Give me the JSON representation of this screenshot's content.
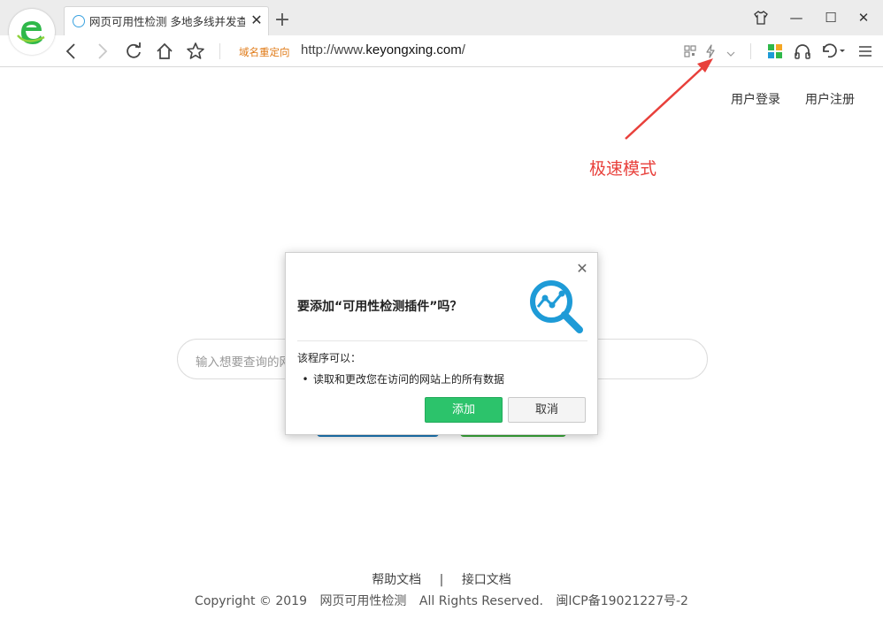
{
  "browser": {
    "tab": {
      "title": "网页可用性检测 多地多线并发查询"
    },
    "address": {
      "redirect_label": "域名重定向",
      "url_prefix": "http://www.",
      "url_domain": "keyongxing.com",
      "url_suffix": "/"
    }
  },
  "page": {
    "top_links": [
      "用户登录",
      "用户注册"
    ],
    "annotation": "极速模式",
    "search_placeholder": "输入想要查询的网",
    "footer": {
      "links": [
        "帮助文档",
        "|",
        "接口文档"
      ],
      "copyright": [
        "Copyright © 2019",
        "网页可用性检测",
        "All Rights Reserved.",
        "闽ICP备19021227号-2"
      ]
    }
  },
  "dialog": {
    "title": "要添加“可用性检测插件”吗？",
    "permission_heading": "该程序可以：",
    "permissions": [
      "读取和更改您在访问的网站上的所有数据"
    ],
    "add_label": "添加",
    "cancel_label": "取消"
  },
  "colors": {
    "accent_green": "#2cc36b",
    "annotation_red": "#e8403b",
    "redirect_orange": "#e07b18",
    "icon_blue": "#1e9bd7"
  },
  "icons": [
    "browser-logo-icon",
    "tab-favicon-icon",
    "back-icon",
    "forward-icon",
    "refresh-icon",
    "home-icon",
    "star-icon",
    "qrcode-icon",
    "lightning-icon",
    "chevron-down-icon",
    "apps-icon",
    "headphones-icon",
    "undo-icon",
    "menu-icon",
    "search-chart-icon",
    "close-icon",
    "shirt-icon"
  ]
}
